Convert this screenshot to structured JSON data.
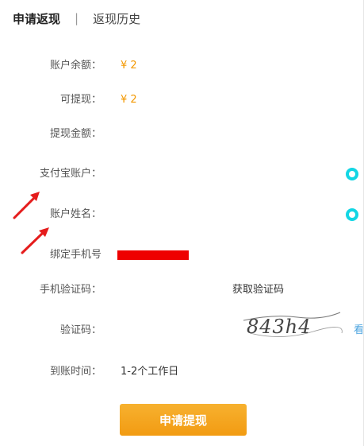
{
  "header": {
    "tab_apply": "申请返现",
    "separator": "|",
    "tab_history": "返现历史"
  },
  "form": {
    "balance_label": "账户余额：",
    "balance_value": "¥ 2",
    "withdrawable_label": "可提现：",
    "withdrawable_value": "¥ 2",
    "amount_label": "提现金额：",
    "alipay_label": "支付宝账户：",
    "name_label": "账户姓名：",
    "phone_label": "绑定手机号",
    "sms_code_label": "手机验证码：",
    "get_code_label": "获取验证码",
    "captcha_label": "验证码：",
    "captcha_text": "843h4",
    "captcha_refresh_label": "看",
    "arrival_label": "到账时间：",
    "arrival_value": "1-2个工作日"
  },
  "submit_label": "申请提现",
  "colors": {
    "accent_orange": "#f39800",
    "button_orange": "#f5a623",
    "redaction_red": "#ee0000",
    "icon_cyan": "#12d6e4"
  },
  "icons": {
    "alipay_status": "cyan-circle-icon",
    "name_status": "cyan-circle-icon"
  }
}
